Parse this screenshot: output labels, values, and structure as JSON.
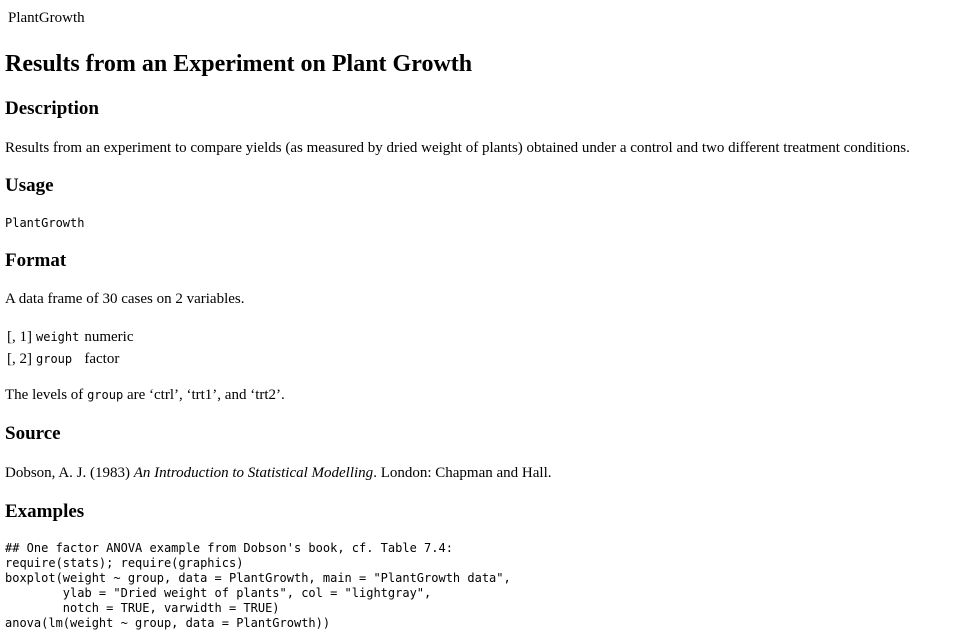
{
  "topic_name": "PlantGrowth",
  "title": "Results from an Experiment on Plant Growth",
  "sections": {
    "description": {
      "heading": "Description",
      "text": "Results from an experiment to compare yields (as measured by dried weight of plants) obtained under a control and two different treatment conditions."
    },
    "usage": {
      "heading": "Usage",
      "code": "PlantGrowth"
    },
    "format": {
      "heading": "Format",
      "intro": "A data frame of 30 cases on 2 variables.",
      "rows": [
        {
          "index": "[, 1]",
          "name": "weight",
          "type": "numeric"
        },
        {
          "index": "[, 2]",
          "name": "group",
          "type": "factor"
        }
      ],
      "levels_prefix": "The levels of ",
      "levels_code": "group",
      "levels_suffix": " are ‘ctrl’, ‘trt1’, and ‘trt2’."
    },
    "source": {
      "heading": "Source",
      "author": "Dobson, A. J. (1983) ",
      "book_title": "An Introduction to Statistical Modelling",
      "publisher": ". London: Chapman and Hall."
    },
    "examples": {
      "heading": "Examples",
      "lines": [
        "## One factor ANOVA example from Dobson's book, cf. Table 7.4:",
        "require(stats); require(graphics)",
        "boxplot(weight ~ group, data = PlantGrowth, main = \"PlantGrowth data\",",
        "        ylab = \"Dried weight of plants\", col = \"lightgray\",",
        "        notch = TRUE, varwidth = TRUE)",
        "anova(lm(weight ~ group, data = PlantGrowth))"
      ]
    }
  }
}
